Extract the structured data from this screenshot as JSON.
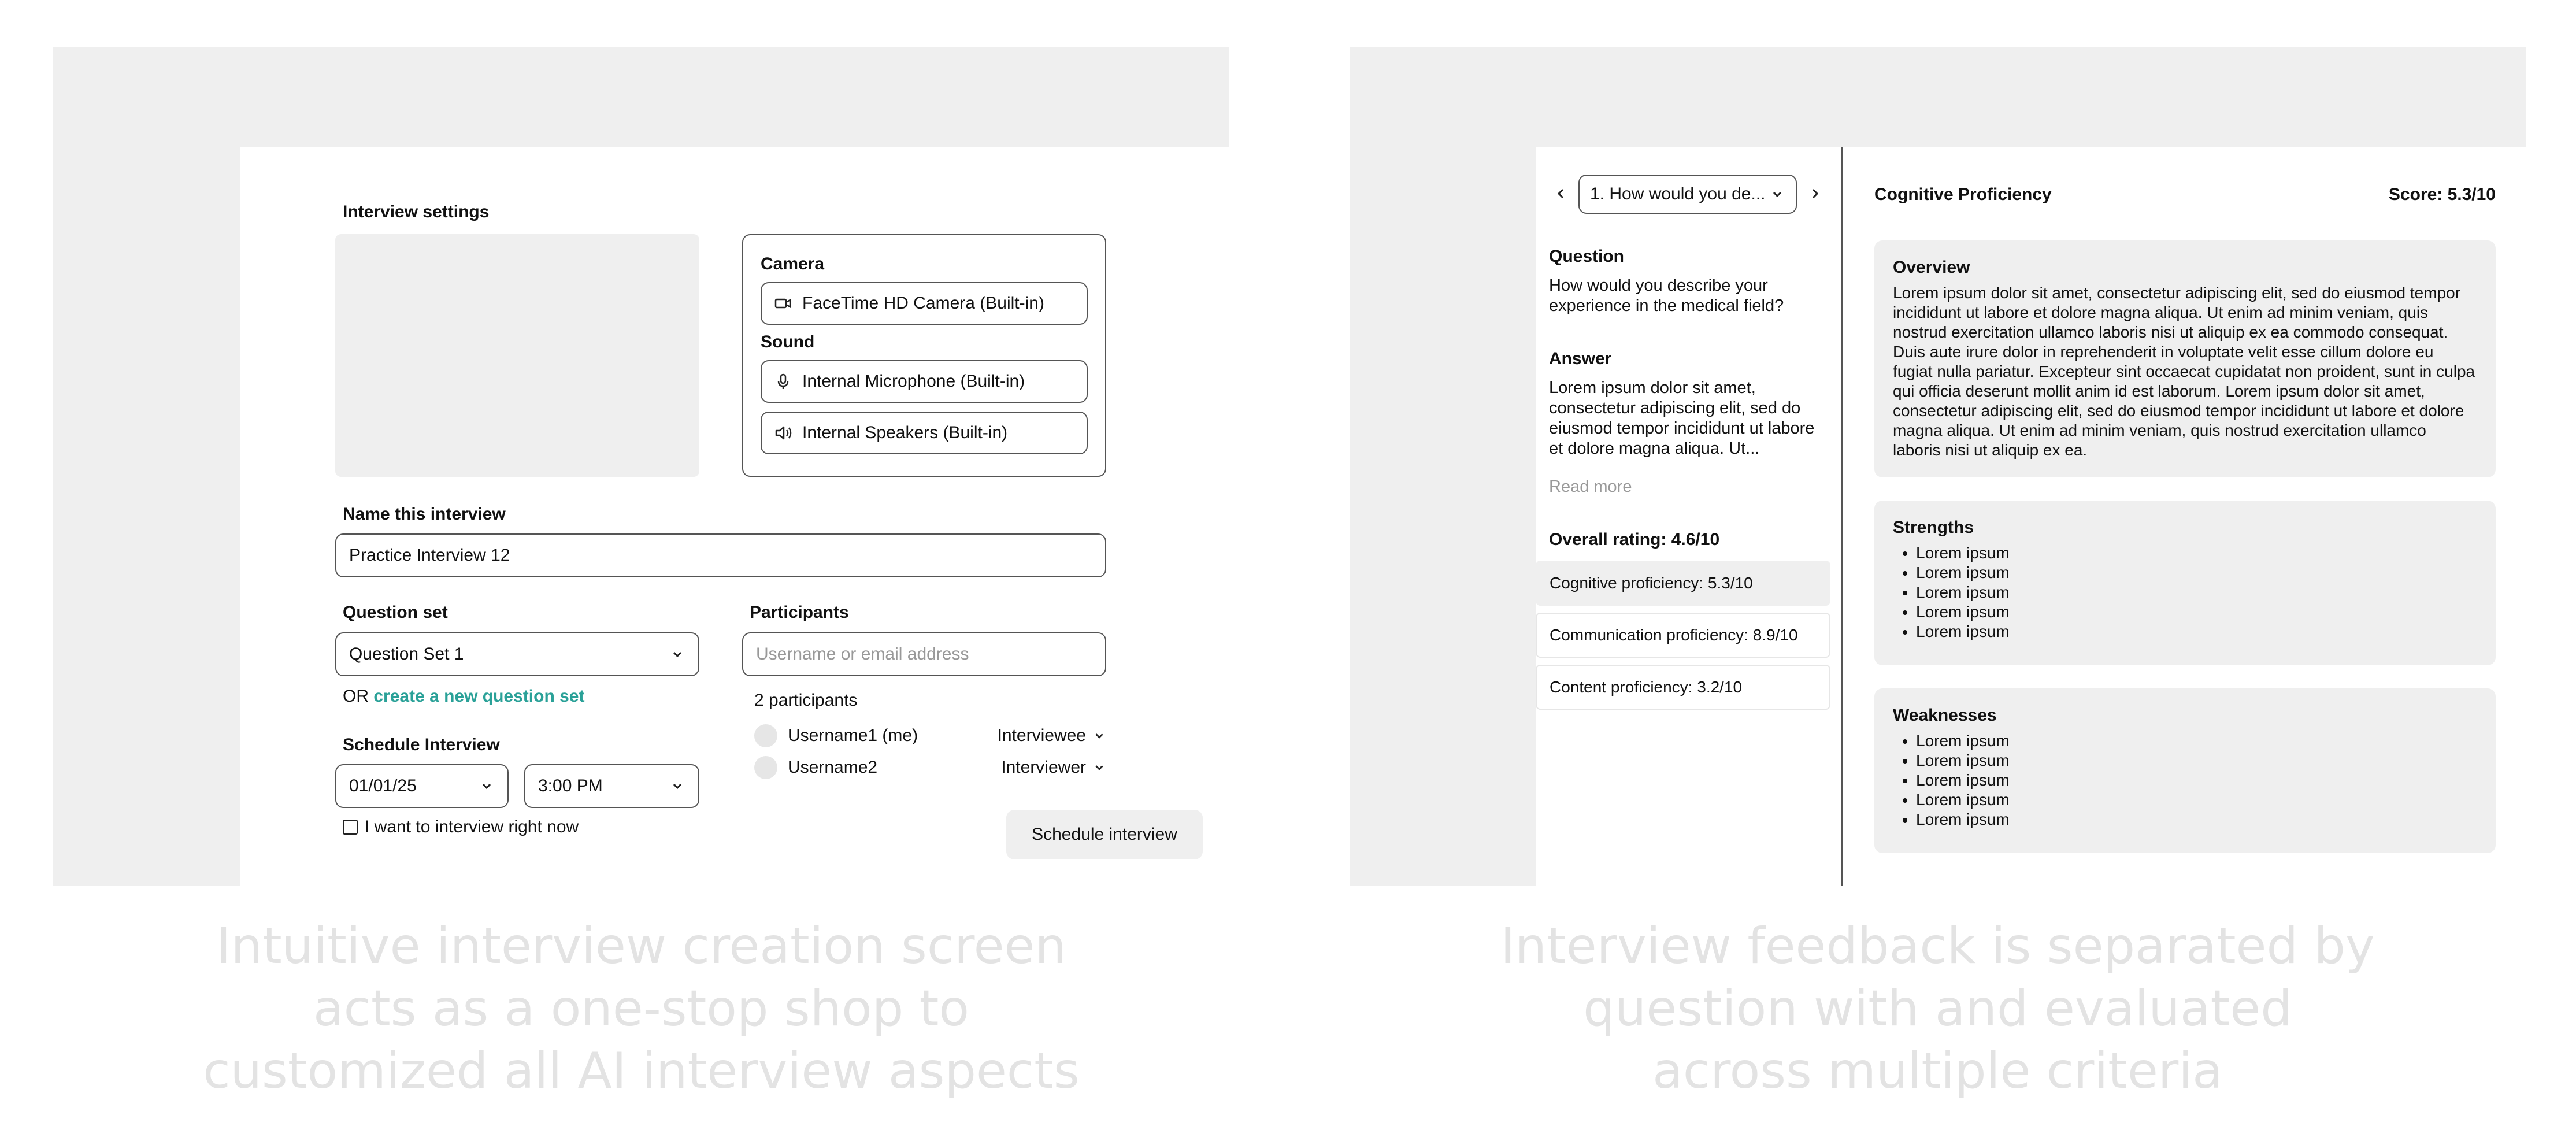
{
  "left": {
    "section_title": "Interview settings",
    "camera": {
      "label": "Camera",
      "value": "FaceTime HD Camera (Built-in)"
    },
    "sound": {
      "label": "Sound",
      "mic": "Internal Microphone (Built-in)",
      "speakers": "Internal Speakers (Built-in)"
    },
    "name": {
      "label": "Name this interview",
      "value": "Practice Interview 12"
    },
    "question_set": {
      "label": "Question set",
      "value": "Question Set 1",
      "or_text": "OR",
      "create_link": "create a new question set"
    },
    "participants": {
      "label": "Participants",
      "placeholder": "Username or email address",
      "count": "2 participants",
      "list": [
        {
          "name": "Username1 (me)",
          "role": "Interviewee"
        },
        {
          "name": "Username2",
          "role": "Interviewer"
        }
      ]
    },
    "schedule": {
      "label": "Schedule Interview",
      "date": "01/01/25",
      "time": "3:00 PM",
      "now_checkbox": "I want to interview right now"
    },
    "schedule_button": "Schedule interview",
    "caption": [
      "Intuitive interview creation screen",
      "acts as a one-stop shop to",
      "customized all AI interview aspects"
    ]
  },
  "right": {
    "question_select": "1. How would you de...",
    "question_label": "Question",
    "question_text": "How would you describe your experience in the medical field?",
    "answer_label": "Answer",
    "answer_text": "Lorem ipsum dolor sit amet, consectetur adipiscing elit, sed do eiusmod tempor incididunt ut labore et dolore magna aliqua. Ut...",
    "read_more": "Read more",
    "overall_rating": "Overall rating: 4.6/10",
    "ratings": [
      "Cognitive proficiency: 5.3/10",
      "Communication proficiency: 8.9/10",
      "Content proficiency: 3.2/10"
    ],
    "detail_title": "Cognitive Proficiency",
    "score": "Score: 5.3/10",
    "overview": {
      "title": "Overview",
      "text": "Lorem ipsum dolor sit amet, consectetur adipiscing elit, sed do eiusmod tempor incididunt ut labore et dolore magna aliqua. Ut enim ad minim veniam, quis nostrud exercitation ullamco laboris nisi ut aliquip ex ea commodo consequat. Duis aute irure dolor in reprehenderit in voluptate velit esse cillum dolore eu fugiat nulla pariatur. Excepteur sint occaecat cupidatat non proident, sunt in culpa qui officia deserunt mollit anim id est laborum. Lorem ipsum dolor sit amet, consectetur adipiscing elit, sed do eiusmod tempor incididunt ut labore et dolore magna aliqua. Ut enim ad minim veniam, quis nostrud exercitation ullamco laboris nisi ut aliquip ex ea."
    },
    "strengths": {
      "title": "Strengths",
      "items": [
        "Lorem ipsum",
        "Lorem ipsum",
        "Lorem ipsum",
        "Lorem ipsum",
        "Lorem ipsum"
      ]
    },
    "weaknesses": {
      "title": "Weaknesses",
      "items": [
        "Lorem ipsum",
        "Lorem ipsum",
        "Lorem ipsum",
        "Lorem ipsum",
        "Lorem ipsum"
      ]
    },
    "caption": [
      "Interview feedback is separated by",
      "question with and evaluated",
      "across multiple criteria"
    ]
  }
}
